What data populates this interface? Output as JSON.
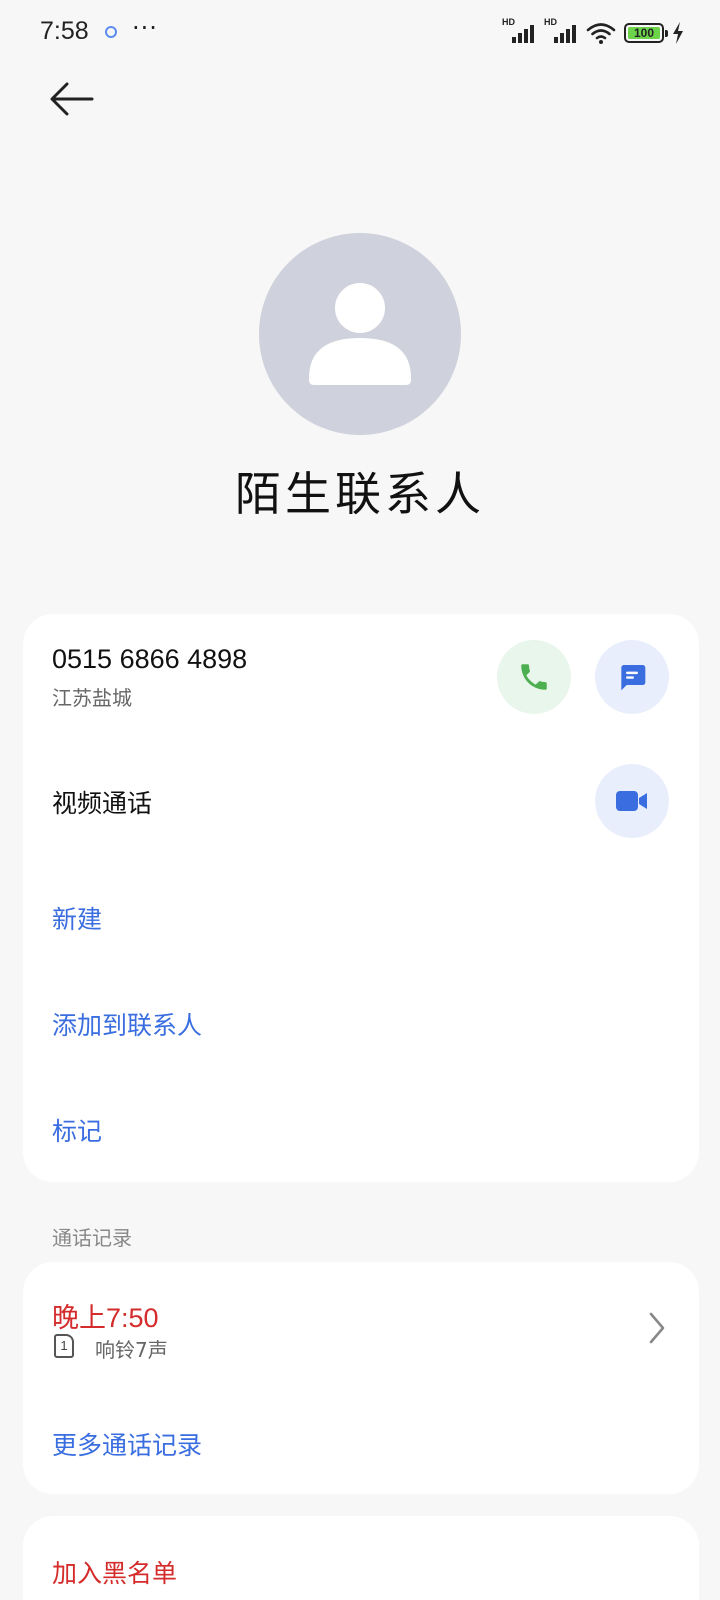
{
  "status_bar": {
    "time": "7:58",
    "more": "···",
    "battery_level": "100",
    "signal_label": "HD"
  },
  "contact": {
    "name": "陌生联系人",
    "phone_number": "0515 6866 4898",
    "location": "江苏盐城"
  },
  "actions": {
    "video_call_label": "视频通话",
    "new_label": "新建",
    "add_to_contacts_label": "添加到联系人",
    "mark_label": "标记"
  },
  "call_log": {
    "section_title": "通话记录",
    "entries": [
      {
        "time": "晚上7:50",
        "sim": "1",
        "detail": "响铃7声"
      }
    ],
    "more_label": "更多通话记录"
  },
  "block": {
    "label": "加入黑名单"
  },
  "colors": {
    "link_blue": "#3a6ee0",
    "missed_red": "#d42b2b",
    "call_green": "#4caf50",
    "avatar_gray": "#cfd1dc"
  },
  "icons": [
    "back-arrow-icon",
    "phone-icon",
    "message-icon",
    "video-camera-icon",
    "person-icon",
    "chevron-right-icon",
    "sim-card-icon",
    "wifi-icon",
    "battery-icon",
    "charging-icon"
  ]
}
